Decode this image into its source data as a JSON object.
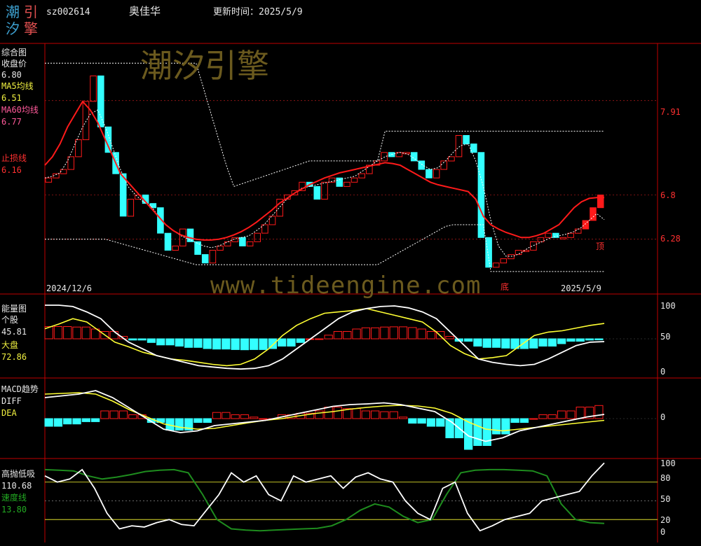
{
  "header": {
    "logo": [
      "潮",
      "引",
      "汐",
      "擎"
    ],
    "code": "sz002614",
    "name": "奥佳华",
    "update_label": "更新时间：2025/5/9"
  },
  "watermark": {
    "brand": "潮汐引擎",
    "url": "www.tideengine.com"
  },
  "colors": {
    "red": "#ff1a1a",
    "cyan": "#33ffff",
    "yellow": "#ffff33",
    "white": "#ffffff",
    "green": "#1e8c1e",
    "axis": "#c00000"
  },
  "panel1": {
    "title": "综合图",
    "close_label": "收盘价",
    "close_value": "6.80",
    "ma5_label": "MA5均线",
    "ma5_value": "6.51",
    "ma60_label": "MA60均线",
    "ma60_value": "6.77",
    "stop_label": "止损线",
    "stop_value": "6.16",
    "date_left": "2024/12/6",
    "date_right": "2025/5/9",
    "ticks": [
      "7.91",
      "6.8",
      "6.28"
    ],
    "marker_top": "顶",
    "marker_bottom": "底"
  },
  "panel2": {
    "title": "能量图",
    "stock_label": "个股",
    "stock_value": "45.81",
    "market_label": "大盘",
    "market_value": "72.86",
    "ticks": [
      "100",
      "50",
      "0"
    ]
  },
  "panel3": {
    "title": "MACD趋势",
    "diff_label": "DIFF",
    "dea_label": "DEA",
    "ticks": [
      "0"
    ]
  },
  "panel4": {
    "title": "高抛低吸",
    "value": "110.68",
    "speed_label": "速度线",
    "speed_value": "13.80",
    "ticks": [
      "100",
      "80",
      "50",
      "20",
      "0"
    ]
  },
  "chart_data": [
    {
      "type": "candlestick",
      "panel": "综合图",
      "ylim": [
        5.8,
        8.5
      ],
      "closes": [
        7.0,
        7.05,
        7.1,
        7.25,
        7.45,
        7.9,
        8.2,
        7.6,
        7.3,
        7.05,
        6.55,
        6.75,
        6.8,
        6.7,
        6.65,
        6.35,
        6.15,
        6.2,
        6.4,
        6.25,
        6.1,
        6.0,
        6.15,
        6.2,
        6.25,
        6.3,
        6.2,
        6.25,
        6.35,
        6.45,
        6.55,
        6.75,
        6.8,
        6.85,
        6.95,
        6.9,
        6.75,
        6.95,
        7.0,
        6.9,
        6.95,
        7.0,
        7.05,
        7.15,
        7.2,
        7.3,
        7.25,
        7.3,
        7.3,
        7.2,
        7.1,
        7.0,
        7.1,
        7.2,
        7.25,
        7.5,
        7.4,
        7.3,
        6.3,
        5.95,
        6.0,
        6.05,
        6.1,
        6.15,
        6.15,
        6.25,
        6.3,
        6.35,
        6.3,
        6.3,
        6.35,
        6.4,
        6.5,
        6.65,
        6.8
      ],
      "ma5": [
        7.0,
        7.02,
        7.06,
        7.2,
        7.4,
        7.6,
        7.75,
        7.8,
        7.6,
        7.35,
        7.1,
        6.9,
        6.8,
        6.72,
        6.68,
        6.55,
        6.45,
        6.38,
        6.32,
        6.28,
        6.24,
        6.2,
        6.18,
        6.2,
        6.24,
        6.28,
        6.3,
        6.32,
        6.38,
        6.45,
        6.55,
        6.65,
        6.75,
        6.82,
        6.88,
        6.9,
        6.92,
        6.94,
        6.96,
        6.98,
        7.0,
        7.02,
        7.08,
        7.14,
        7.2,
        7.25,
        7.28,
        7.3,
        7.28,
        7.22,
        7.15,
        7.1,
        7.12,
        7.2,
        7.3,
        7.38,
        7.4,
        7.2,
        6.9,
        6.5,
        6.2,
        6.08,
        6.08,
        6.12,
        6.18,
        6.22,
        6.26,
        6.3,
        6.32,
        6.34,
        6.37,
        6.42,
        6.5,
        6.58,
        6.51
      ],
      "ma60": [
        7.15,
        7.25,
        7.4,
        7.6,
        7.75,
        7.9,
        7.8,
        7.65,
        7.45,
        7.25,
        7.05,
        6.95,
        6.85,
        6.75,
        6.65,
        6.55,
        6.45,
        6.38,
        6.33,
        6.3,
        6.28,
        6.27,
        6.27,
        6.28,
        6.3,
        6.33,
        6.37,
        6.42,
        6.48,
        6.55,
        6.62,
        6.7,
        6.76,
        6.82,
        6.87,
        6.92,
        6.96,
        7.0,
        7.03,
        7.06,
        7.08,
        7.1,
        7.12,
        7.14,
        7.16,
        7.18,
        7.17,
        7.15,
        7.1,
        7.05,
        7.0,
        6.95,
        6.92,
        6.9,
        6.88,
        6.86,
        6.84,
        6.75,
        6.55,
        6.45,
        6.4,
        6.36,
        6.33,
        6.3,
        6.3,
        6.32,
        6.35,
        6.4,
        6.45,
        6.55,
        6.65,
        6.72,
        6.76,
        6.77,
        6.77
      ],
      "stop_line": 6.16,
      "levels": [
        7.91,
        6.8,
        6.28
      ]
    },
    {
      "type": "line",
      "panel": "能量图",
      "ylim": [
        0,
        100
      ],
      "series": [
        {
          "name": "个股",
          "values": [
            100,
            100,
            98,
            90,
            80,
            60,
            45,
            35,
            25,
            20,
            15,
            10,
            8,
            6,
            5,
            6,
            10,
            20,
            35,
            50,
            65,
            80,
            90,
            95,
            98,
            99,
            96,
            90,
            80,
            60,
            40,
            20,
            15,
            12,
            10,
            12,
            20,
            30,
            40,
            45,
            45.81
          ]
        },
        {
          "name": "大盘",
          "values": [
            65,
            72,
            80,
            75,
            60,
            45,
            38,
            30,
            25,
            20,
            18,
            15,
            12,
            10,
            12,
            20,
            35,
            55,
            70,
            80,
            88,
            90,
            92,
            95,
            90,
            85,
            80,
            75,
            60,
            40,
            28,
            20,
            22,
            25,
            40,
            55,
            60,
            62,
            66,
            70,
            72.86
          ]
        }
      ],
      "ticks": [
        0,
        50,
        100
      ]
    },
    {
      "type": "line",
      "panel": "MACD趋势",
      "ylim": [
        -1,
        1
      ],
      "series": [
        {
          "name": "DIFF",
          "values": [
            0.6,
            0.65,
            0.7,
            0.8,
            0.6,
            0.3,
            0.0,
            -0.3,
            -0.4,
            -0.35,
            -0.2,
            -0.15,
            -0.1,
            -0.05,
            0.05,
            0.15,
            0.25,
            0.35,
            0.4,
            0.42,
            0.45,
            0.4,
            0.3,
            0.2,
            -0.1,
            -0.5,
            -0.65,
            -0.55,
            -0.35,
            -0.25,
            -0.15,
            -0.05,
            0.05,
            0.12
          ]
        },
        {
          "name": "DEA",
          "values": [
            0.7,
            0.72,
            0.74,
            0.7,
            0.5,
            0.25,
            0.05,
            -0.15,
            -0.25,
            -0.3,
            -0.28,
            -0.2,
            -0.12,
            -0.05,
            0.0,
            0.08,
            0.15,
            0.2,
            0.27,
            0.32,
            0.36,
            0.38,
            0.36,
            0.3,
            0.15,
            -0.1,
            -0.3,
            -0.35,
            -0.3,
            -0.25,
            -0.2,
            -0.15,
            -0.1,
            -0.05
          ]
        }
      ],
      "ticks": [
        0
      ]
    },
    {
      "type": "line",
      "panel": "高抛低吸",
      "ylim": [
        0,
        100
      ],
      "series": [
        {
          "name": "高抛低吸",
          "values": [
            90,
            80,
            85,
            100,
            70,
            30,
            5,
            10,
            8,
            15,
            20,
            12,
            10,
            35,
            60,
            95,
            80,
            90,
            60,
            50,
            90,
            80,
            85,
            90,
            70,
            88,
            95,
            85,
            80,
            50,
            30,
            20,
            70,
            80,
            30,
            2,
            10,
            20,
            25,
            30,
            50,
            55,
            60,
            65,
            90,
            110.68
          ]
        },
        {
          "name": "速度线",
          "values": [
            100,
            99,
            98,
            90,
            85,
            88,
            92,
            97,
            99,
            100,
            95,
            60,
            20,
            5,
            3,
            2,
            3,
            4,
            5,
            6,
            10,
            20,
            35,
            45,
            40,
            25,
            15,
            20,
            60,
            95,
            99,
            100,
            100,
            99,
            98,
            90,
            45,
            20,
            15,
            13.8
          ]
        }
      ],
      "levels": [
        80,
        50,
        20
      ]
    }
  ]
}
